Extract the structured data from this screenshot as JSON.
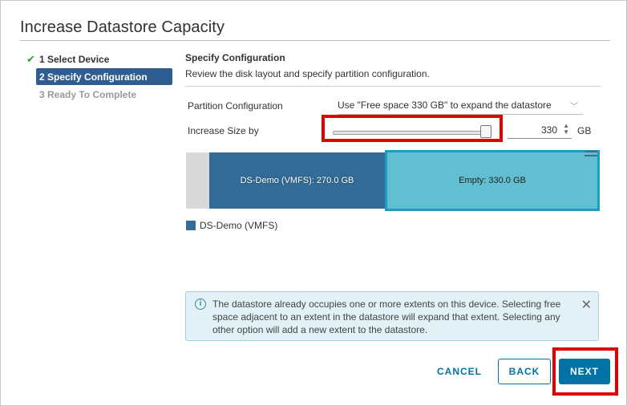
{
  "dialog": {
    "title": "Increase Datastore Capacity"
  },
  "wizard": {
    "steps": [
      {
        "label": "1 Select Device",
        "state": "completed"
      },
      {
        "label": "2 Specify Configuration",
        "state": "active"
      },
      {
        "label": "3 Ready To Complete",
        "state": "future"
      }
    ]
  },
  "section": {
    "title": "Specify Configuration",
    "description": "Review the disk layout and specify partition configuration."
  },
  "form": {
    "partition_label": "Partition Configuration",
    "partition_value": "Use \"Free space 330 GB\" to expand the datastore",
    "increase_label": "Increase Size by",
    "increase_value": "330",
    "increase_unit": "GB",
    "slider_fraction": 1.0
  },
  "disk_layout": {
    "segments": [
      {
        "label": "",
        "type": "unallocated"
      },
      {
        "label": "DS-Demo (VMFS): 270.0 GB",
        "type": "datastore"
      },
      {
        "label": "Empty: 330.0 GB",
        "type": "empty",
        "selected": true
      }
    ],
    "legend": [
      {
        "label": "DS-Demo (VMFS)",
        "color": "#336c96"
      }
    ]
  },
  "info": {
    "text": "The datastore already occupies one or more extents on this device. Selecting free space adjacent to an extent in the datastore will expand that extent. Selecting any other option will add a new extent to the datastore."
  },
  "buttons": {
    "cancel": "CANCEL",
    "back": "BACK",
    "next": "NEXT"
  },
  "colors": {
    "accent": "#0072a3",
    "datastore": "#336c96",
    "empty": "#62bfd1",
    "highlight": "#e10000",
    "success": "#3c9a3c"
  }
}
